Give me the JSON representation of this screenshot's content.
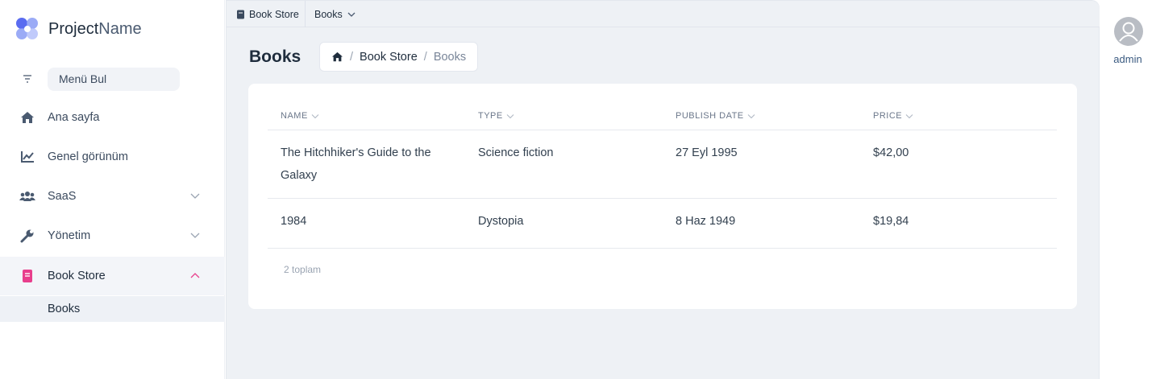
{
  "brand": {
    "name_bold": "Project",
    "name_light": "Name"
  },
  "sidebar": {
    "search_label": "Menü Bul",
    "items": [
      {
        "label": "Ana sayfa",
        "icon": "home-icon"
      },
      {
        "label": "Genel görünüm",
        "icon": "chart-line-icon"
      },
      {
        "label": "SaaS",
        "icon": "users-icon",
        "expandable": true
      },
      {
        "label": "Yönetim",
        "icon": "wrench-icon",
        "expandable": true
      },
      {
        "label": "Book Store",
        "icon": "book-icon",
        "expandable": true,
        "expanded": true
      }
    ],
    "sub_items": [
      {
        "label": "Books"
      }
    ]
  },
  "tabs": [
    {
      "label": "Book Store",
      "icon": "book-icon"
    },
    {
      "label": "Books",
      "icon": "chevron-down-icon"
    }
  ],
  "page": {
    "title": "Books",
    "breadcrumb": {
      "home_icon": "home-icon",
      "link": "Book Store",
      "current": "Books"
    }
  },
  "table": {
    "columns": [
      "NAME",
      "TYPE",
      "PUBLISH DATE",
      "PRICE"
    ],
    "rows": [
      {
        "name": "The Hitchhiker's Guide to the Galaxy",
        "type": "Science fiction",
        "publish_date": "27 Eyl 1995",
        "price": "$42,00"
      },
      {
        "name": "1984",
        "type": "Dystopia",
        "publish_date": "8 Haz 1949",
        "price": "$19,84"
      }
    ],
    "total_text": "2 toplam"
  },
  "user": {
    "name": "admin"
  },
  "colors": {
    "accent": "#e83e8c",
    "brand_blue": "#4f6cf0",
    "background": "#eef1f5"
  }
}
